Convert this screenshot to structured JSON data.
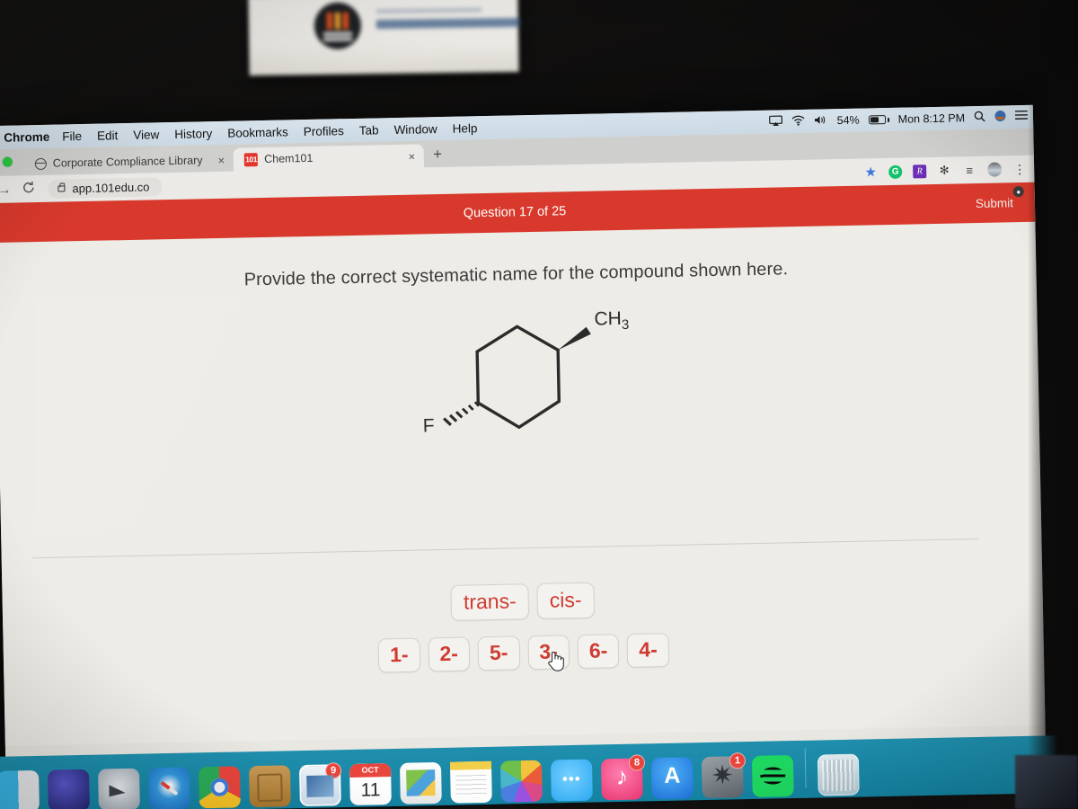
{
  "menubar": {
    "app_name": "Chrome",
    "items": [
      "File",
      "Edit",
      "View",
      "History",
      "Bookmarks",
      "Profiles",
      "Tab",
      "Window",
      "Help"
    ],
    "status": {
      "airplay_icon": "airplay-icon",
      "wifi_icon": "wifi-icon",
      "volume_icon": "volume-icon",
      "battery_percent": "54%",
      "clock": "Mon 8:12 PM",
      "spotlight_icon": "search-icon",
      "siri_icon": "siri-icon",
      "control_center_icon": "list-icon"
    }
  },
  "browser": {
    "tabs": [
      {
        "title": "Corporate Compliance Library",
        "favicon": "globe-icon",
        "active": false
      },
      {
        "title": "Chem101",
        "favicon": "101-favicon",
        "active": true
      }
    ],
    "new_tab_label": "+",
    "close_label": "×",
    "omnibox": {
      "url": "app.101edu.co",
      "lock_icon": "lock-icon",
      "forward_icon": "forward-arrow-icon",
      "reload_icon": "reload-icon"
    },
    "extensions": [
      {
        "name": "bookmark-star-icon",
        "glyph": "★"
      },
      {
        "name": "grammarly-icon",
        "glyph": "G"
      },
      {
        "name": "rx-extension-icon",
        "glyph": "R"
      },
      {
        "name": "puzzle-extensions-icon",
        "glyph": "✻"
      },
      {
        "name": "reading-list-icon",
        "glyph": "≡"
      },
      {
        "name": "profile-avatar",
        "glyph": ""
      },
      {
        "name": "chrome-menu-icon",
        "glyph": "⋮"
      }
    ]
  },
  "quiz": {
    "progress_label": "Question 17 of 25",
    "submit_label": "Submit",
    "prompt": "Provide the correct systematic name for the compound shown here.",
    "molecule": {
      "substituent_top_right": "CH3",
      "substituent_top_right_text": "CH",
      "substituent_top_right_sub": "3",
      "substituent_bottom_left": "F",
      "ring": "cyclohexane",
      "wedge_bond": "solid-wedge-to-methyl",
      "hash_bond": "hashed-wedge-to-fluorine"
    },
    "answer_rows": [
      {
        "row": 1,
        "options": [
          "trans-",
          "cis-"
        ]
      },
      {
        "row": 2,
        "options": [
          "1-",
          "2-",
          "5-",
          "3-",
          "6-",
          "4-"
        ]
      }
    ],
    "colors": {
      "header_red": "#d8392c",
      "answer_text_red": "#cf3b31",
      "page_bg": "#eeece7"
    }
  },
  "dock": {
    "items": [
      {
        "name": "finder",
        "badge": ""
      },
      {
        "name": "launchpad",
        "badge": ""
      },
      {
        "name": "mission-control",
        "badge": ""
      },
      {
        "name": "safari",
        "badge": ""
      },
      {
        "name": "chrome",
        "badge": ""
      },
      {
        "name": "contacts",
        "badge": ""
      },
      {
        "name": "mail",
        "badge": "9"
      },
      {
        "name": "calendar",
        "badge": "",
        "month": "OCT",
        "day": "11"
      },
      {
        "name": "preview",
        "badge": ""
      },
      {
        "name": "notes",
        "badge": ""
      },
      {
        "name": "photos",
        "badge": ""
      },
      {
        "name": "messages",
        "badge": ""
      },
      {
        "name": "itunes",
        "badge": "8"
      },
      {
        "name": "app-store",
        "badge": ""
      },
      {
        "name": "system-preferences",
        "badge": "1"
      },
      {
        "name": "spotify",
        "badge": ""
      },
      {
        "name": "trash",
        "badge": ""
      }
    ]
  },
  "cursor": {
    "type": "pointing-hand",
    "over": "cis-"
  }
}
